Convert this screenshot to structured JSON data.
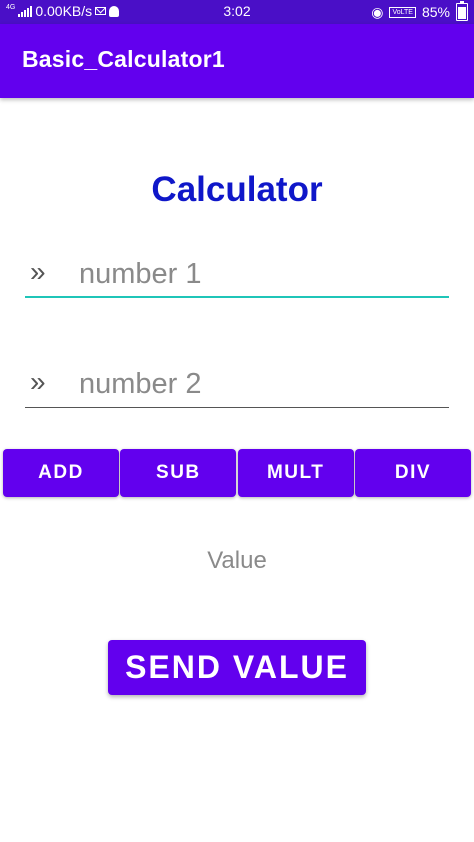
{
  "status_bar": {
    "network_type": "4G",
    "data_rate": "0.00KB/s",
    "time": "3:02",
    "volte_label": "VoLTE",
    "battery": "85%",
    "battery_level": 0.85,
    "icons": [
      "signal-icon",
      "mail-icon",
      "snapchat-icon",
      "eye-icon",
      "volte-icon",
      "battery-icon"
    ]
  },
  "app_bar": {
    "title": "Basic_Calculator1",
    "color": "#6200ee"
  },
  "main": {
    "heading": "Calculator",
    "heading_color": "#0f17c9",
    "input1": {
      "placeholder": "number 1",
      "value": "",
      "icon": "double-chevron-icon"
    },
    "input2": {
      "placeholder": "number 2",
      "value": "",
      "icon": "double-chevron-icon"
    },
    "operations": [
      {
        "label": "ADD"
      },
      {
        "label": "SUB"
      },
      {
        "label": "MULT"
      },
      {
        "label": "DIV"
      }
    ],
    "result_text": "Value",
    "send_button": "SEND VALUE"
  }
}
